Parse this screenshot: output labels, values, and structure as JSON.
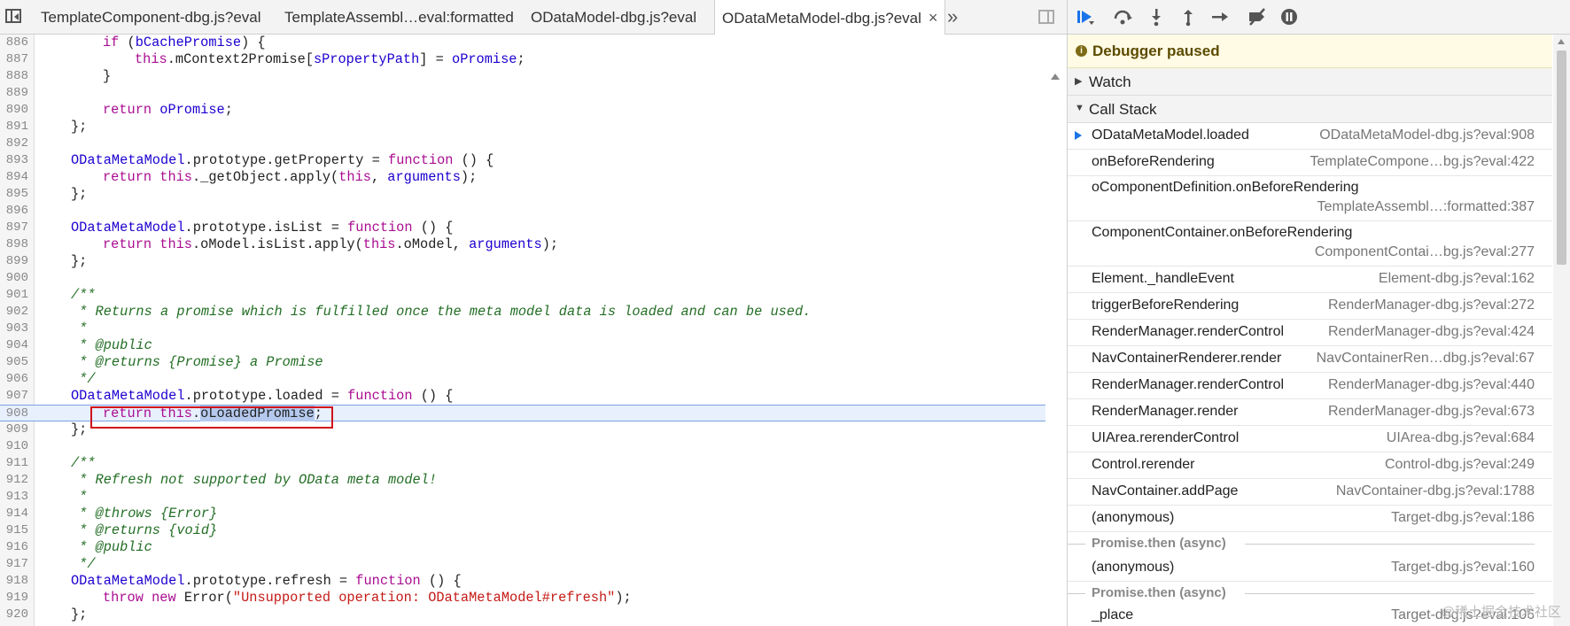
{
  "tabs": [
    {
      "label": "TemplateComponent-dbg.js?eval"
    },
    {
      "label": "TemplateAssembl…eval:formatted"
    },
    {
      "label": "ODataModel-dbg.js?eval"
    },
    {
      "label": "ODataMetaModel-dbg.js?eval",
      "active": true
    }
  ],
  "icons": {
    "close": "×",
    "more": "»"
  },
  "code": {
    "current_line": "908",
    "lines": [
      {
        "n": "886"
      },
      {
        "n": "887"
      },
      {
        "n": "888"
      },
      {
        "n": "889"
      },
      {
        "n": "890"
      },
      {
        "n": "891"
      },
      {
        "n": "892"
      },
      {
        "n": "893"
      },
      {
        "n": "894"
      },
      {
        "n": "895"
      },
      {
        "n": "896"
      },
      {
        "n": "897"
      },
      {
        "n": "898"
      },
      {
        "n": "899"
      },
      {
        "n": "900"
      },
      {
        "n": "901"
      },
      {
        "n": "902"
      },
      {
        "n": "903"
      },
      {
        "n": "904"
      },
      {
        "n": "905"
      },
      {
        "n": "906"
      },
      {
        "n": "907"
      },
      {
        "n": "908"
      },
      {
        "n": "909"
      },
      {
        "n": "910"
      },
      {
        "n": "911"
      },
      {
        "n": "912"
      },
      {
        "n": "913"
      },
      {
        "n": "914"
      },
      {
        "n": "915"
      },
      {
        "n": "916"
      },
      {
        "n": "917"
      },
      {
        "n": "918"
      },
      {
        "n": "919"
      },
      {
        "n": "920"
      }
    ],
    "text": {
      "l886": [
        "if",
        " (",
        "bCachePromise",
        ") {"
      ],
      "l887": [
        "this",
        ".mContext2Promise[",
        "sPropertyPath",
        "] = ",
        "oPromise",
        ";"
      ],
      "l888": "}",
      "l890": [
        "return",
        " ",
        "oPromise",
        ";"
      ],
      "l891": "};",
      "l893": [
        "ODataMetaModel",
        ".prototype.getProperty = ",
        "function",
        " () {"
      ],
      "l894": [
        "return",
        " ",
        "this",
        "._getObject.apply(",
        "this",
        ", ",
        "arguments",
        ");"
      ],
      "l895": "};",
      "l897": [
        "ODataMetaModel",
        ".prototype.isList = ",
        "function",
        " () {"
      ],
      "l898": [
        "return",
        " ",
        "this",
        ".oModel.isList.apply(",
        "this",
        ".oModel, ",
        "arguments",
        ");"
      ],
      "l899": "};",
      "l901": "/**",
      "l902": " * Returns a promise which is fulfilled once the meta model data is loaded and can be used.",
      "l903": " *",
      "l904": " * @public",
      "l905": " * @returns {Promise} a Promise",
      "l906": " */",
      "l907": [
        "ODataMetaModel",
        ".prototype.loaded = ",
        "function",
        " () {"
      ],
      "l908": [
        "return",
        " ",
        "this",
        ".",
        "oLoadedPromise",
        ";"
      ],
      "l909": "};",
      "l911": "/**",
      "l912": " * Refresh not supported by OData meta model!",
      "l913": " *",
      "l914": " * @throws {Error}",
      "l915": " * @returns {void}",
      "l916": " * @public",
      "l917": " */",
      "l918": [
        "ODataMetaModel",
        ".prototype.refresh = ",
        "function",
        " () {"
      ],
      "l919": [
        "throw",
        " ",
        "new",
        " Error(",
        "\"Unsupported operation: ODataMetaModel#refresh\"",
        ");"
      ],
      "l920": "};"
    }
  },
  "debugger": {
    "paused_label": "Debugger paused",
    "watch_label": "Watch",
    "callstack_label": "Call Stack",
    "frames": [
      {
        "name": "ODataMetaModel.loaded",
        "loc": "ODataMetaModel-dbg.js?eval:908",
        "current": true
      },
      {
        "name": "onBeforeRendering",
        "loc": "TemplateCompone…bg.js?eval:422"
      },
      {
        "name": "oComponentDefinition.onBeforeRendering",
        "loc": "TemplateAssembl…:formatted:387",
        "two_line": true
      },
      {
        "name": "ComponentContainer.onBeforeRendering",
        "loc": "ComponentContai…bg.js?eval:277",
        "two_line": true
      },
      {
        "name": "Element._handleEvent",
        "loc": "Element-dbg.js?eval:162"
      },
      {
        "name": "triggerBeforeRendering",
        "loc": "RenderManager-dbg.js?eval:272"
      },
      {
        "name": "RenderManager.renderControl",
        "loc": "RenderManager-dbg.js?eval:424"
      },
      {
        "name": "NavContainerRenderer.render",
        "loc": "NavContainerRen…dbg.js?eval:67"
      },
      {
        "name": "RenderManager.renderControl",
        "loc": "RenderManager-dbg.js?eval:440"
      },
      {
        "name": "RenderManager.render",
        "loc": "RenderManager-dbg.js?eval:673"
      },
      {
        "name": "UIArea.rerenderControl",
        "loc": "UIArea-dbg.js?eval:684"
      },
      {
        "name": "Control.rerender",
        "loc": "Control-dbg.js?eval:249"
      },
      {
        "name": "NavContainer.addPage",
        "loc": "NavContainer-dbg.js?eval:1788"
      },
      {
        "name": "(anonymous)",
        "loc": "Target-dbg.js?eval:186"
      },
      {
        "async": "Promise.then (async)"
      },
      {
        "name": "(anonymous)",
        "loc": "Target-dbg.js?eval:160"
      },
      {
        "async": "Promise.then (async)"
      },
      {
        "name": "_place",
        "loc": "Target-dbg.js?eval:106"
      }
    ]
  },
  "watermark": "@稀土掘金技术社区"
}
